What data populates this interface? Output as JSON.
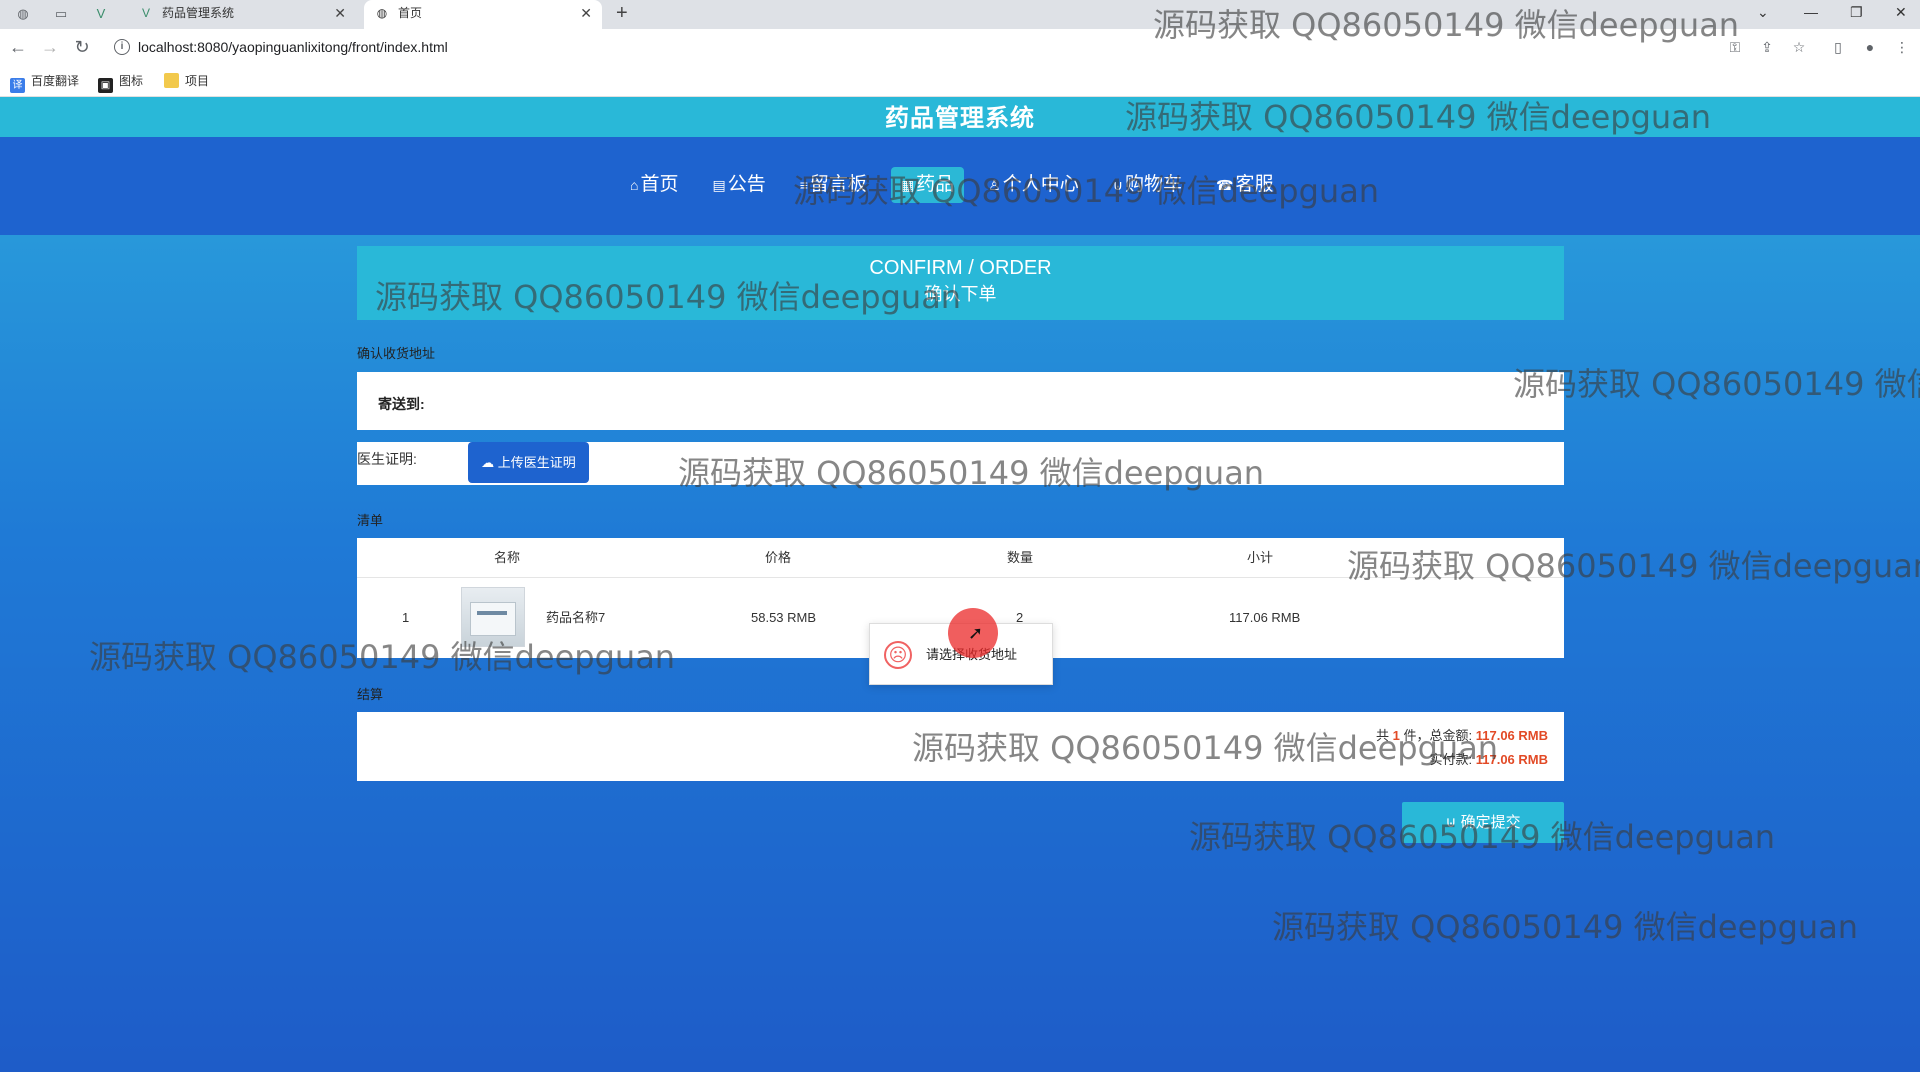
{
  "browser": {
    "tabs": [
      {
        "title": "药品管理系统",
        "active": false
      },
      {
        "title": "首页",
        "active": true
      }
    ],
    "url": "localhost:8080/yaopinguanlixitong/front/index.html",
    "bookmarks": [
      "百度翻译",
      "图标",
      "项目"
    ]
  },
  "site": {
    "title": "药品管理系统",
    "nav": [
      {
        "icon": "⌂",
        "label": "首页",
        "active": false
      },
      {
        "icon": "▤",
        "label": "公告",
        "active": false
      },
      {
        "icon": "≡",
        "label": "留言板",
        "active": false
      },
      {
        "icon": "▦",
        "label": "药品",
        "active": true
      },
      {
        "icon": "♙",
        "label": "个人中心",
        "active": false
      },
      {
        "icon": "⊍",
        "label": "购物车",
        "active": false
      },
      {
        "icon": "☎",
        "label": "客服",
        "active": false
      }
    ]
  },
  "confirm": {
    "title_en": "CONFIRM / ORDER",
    "title_zh": "确认下单"
  },
  "address": {
    "section_label": "确认收货地址",
    "send_to_label": "寄送到:"
  },
  "doctor": {
    "label": "医生证明:",
    "upload_button": "上传医生证明"
  },
  "list": {
    "section_label": "清单",
    "headers": [
      "名称",
      "价格",
      "数量",
      "小计"
    ],
    "rows": [
      {
        "index": "1",
        "name": "药品名称7",
        "price": "58.53 RMB",
        "qty": "2",
        "subtotal": "117.06 RMB"
      }
    ]
  },
  "settlement": {
    "section_label": "结算",
    "count_prefix": "共",
    "count": "1",
    "count_suffix": "件，总金额:",
    "total": "117.06 RMB",
    "paid_label": "实付款:",
    "paid": "117.06 RMB"
  },
  "submit_button": "确定提交",
  "toast": {
    "message": "请选择收货地址"
  },
  "watermark": "源码获取 QQ86050149 微信deepguan",
  "colors": {
    "header_cyan": "#29b8d8",
    "nav_blue": "#1e63cf",
    "accent_red": "#e24a26"
  }
}
